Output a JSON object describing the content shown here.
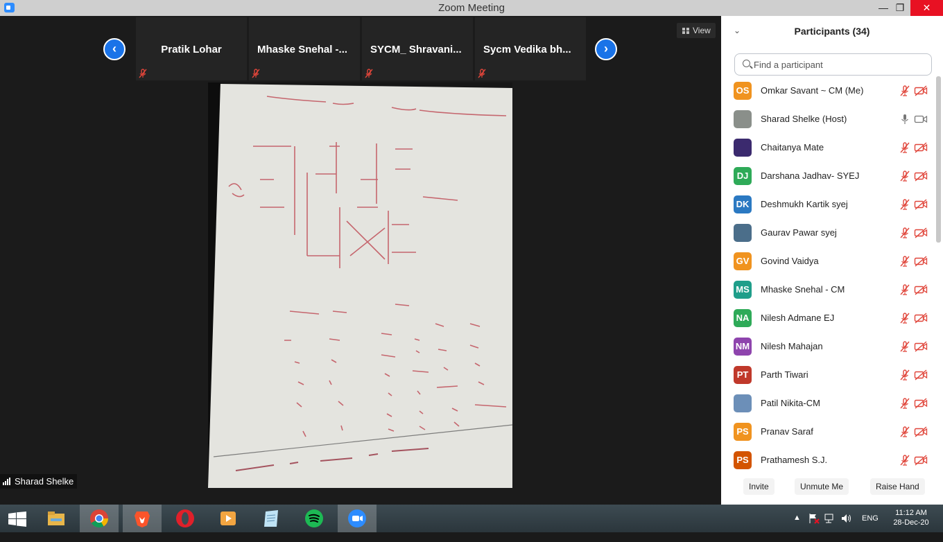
{
  "window": {
    "title": "Zoom Meeting",
    "minimize": "—",
    "maximize": "❐",
    "close": "✕"
  },
  "video": {
    "view_label": "View",
    "speaker_name": "Sharad Shelke",
    "tiles": [
      {
        "name": "Pratik Lohar"
      },
      {
        "name": "Mhaske  Snehal  -..."
      },
      {
        "name": "SYCM_  Shravani..."
      },
      {
        "name": "Sycm  Vedika   bh..."
      }
    ],
    "prev_arrow": "‹",
    "next_arrow": "›"
  },
  "participants": {
    "title": "Participants (34)",
    "search_placeholder": "Find a participant",
    "list": [
      {
        "initials": "OS",
        "name": "Omkar Savant ~ CM (Me)",
        "color": "#f0931f",
        "muted": true,
        "video_off": true
      },
      {
        "initials": "",
        "name": "Sharad Shelke (Host)",
        "color": "#8a8f8a",
        "photo": true,
        "muted": false,
        "video_off": false
      },
      {
        "initials": "",
        "name": "Chaitanya Mate",
        "color": "#3b2a6e",
        "photo": true,
        "muted": true,
        "video_off": true
      },
      {
        "initials": "DJ",
        "name": "Darshana Jadhav- SYEJ",
        "color": "#2eaa58",
        "muted": true,
        "video_off": true
      },
      {
        "initials": "DK",
        "name": "Deshmukh Kartik syej",
        "color": "#2b79c2",
        "muted": true,
        "video_off": true
      },
      {
        "initials": "",
        "name": "Gaurav Pawar syej",
        "color": "#4b6e8a",
        "photo": true,
        "muted": true,
        "video_off": true
      },
      {
        "initials": "GV",
        "name": "Govind Vaidya",
        "color": "#f0931f",
        "muted": true,
        "video_off": true
      },
      {
        "initials": "MS",
        "name": "Mhaske Snehal - CM",
        "color": "#1f9e8a",
        "muted": true,
        "video_off": true
      },
      {
        "initials": "NA",
        "name": "Nilesh Admane EJ",
        "color": "#2eaa58",
        "muted": true,
        "video_off": true
      },
      {
        "initials": "NM",
        "name": "Nilesh Mahajan",
        "color": "#8e44ad",
        "muted": true,
        "video_off": true
      },
      {
        "initials": "PT",
        "name": "Parth Tiwari",
        "color": "#c0392b",
        "muted": true,
        "video_off": true
      },
      {
        "initials": "",
        "name": "Patil Nikita-CM",
        "color": "#6c8fb8",
        "photo": true,
        "muted": true,
        "video_off": true
      },
      {
        "initials": "PS",
        "name": "Pranav Saraf",
        "color": "#f0931f",
        "muted": true,
        "video_off": true
      },
      {
        "initials": "PS",
        "name": "Prathamesh S.J.",
        "color": "#d35400",
        "muted": true,
        "video_off": true
      }
    ],
    "footer": {
      "invite": "Invite",
      "unmute_me": "Unmute Me",
      "raise_hand": "Raise Hand"
    }
  },
  "taskbar": {
    "apps": [
      "windows-start",
      "file-explorer",
      "chrome",
      "brave",
      "opera",
      "media-player",
      "notepad",
      "spotify",
      "zoom"
    ],
    "language": "ENG",
    "time": "11:12 AM",
    "date": "28-Dec-20"
  },
  "colors": {
    "accent_blue": "#1a73e8",
    "mute_red": "#e0453a",
    "close_red": "#e81123"
  }
}
